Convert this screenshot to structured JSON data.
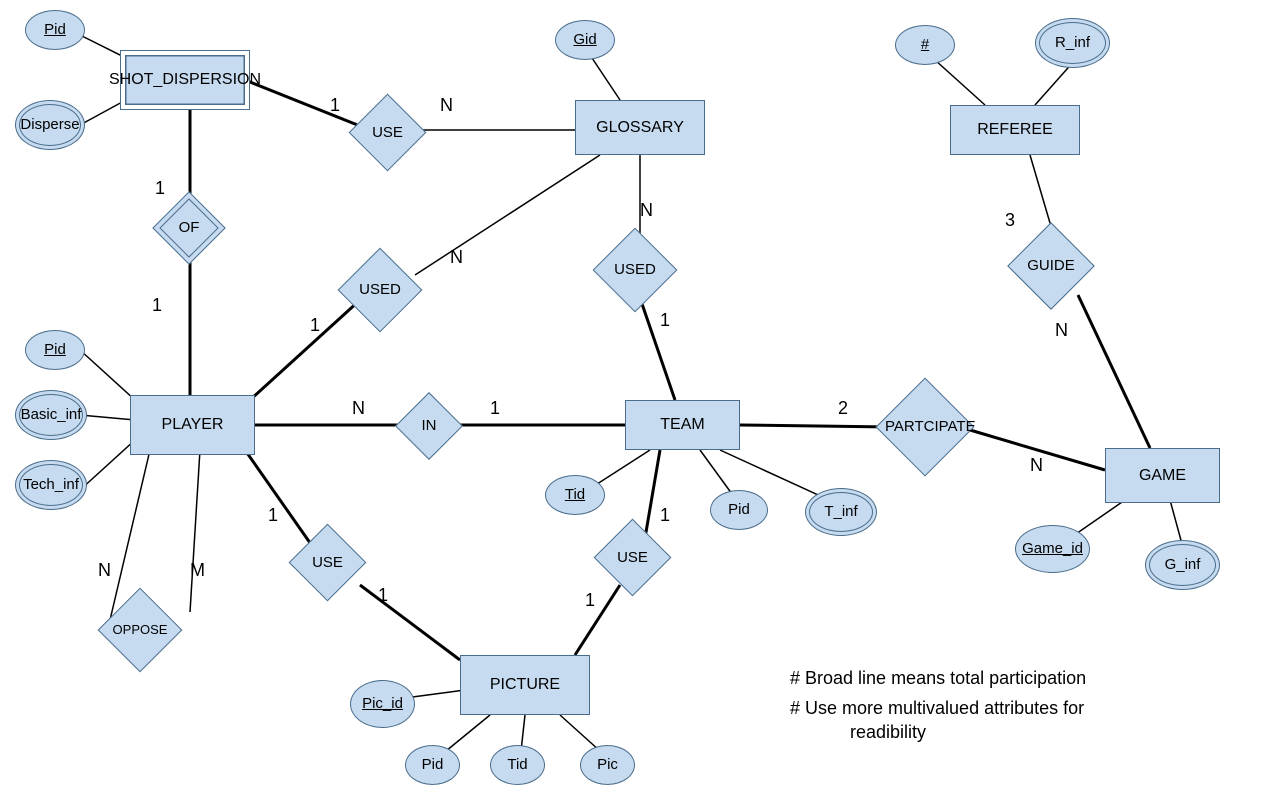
{
  "entities": {
    "shot_dispersion": "SHOT_DISPERSION",
    "glossary": "GLOSSARY",
    "referee": "REFEREE",
    "player": "PLAYER",
    "team": "TEAM",
    "game": "GAME",
    "picture": "PICTURE"
  },
  "attributes": {
    "sd_pid": "Pid",
    "sd_disperse": "Disperse",
    "gl_gid": "Gid",
    "ref_hash": "#",
    "ref_rinf": "R_inf",
    "pl_pid": "Pid",
    "pl_basic": "Basic_inf",
    "pl_tech": "Tech_inf",
    "tm_tid": "Tid",
    "tm_pid": "Pid",
    "tm_tinf": "T_inf",
    "gm_gameid": "Game_id",
    "gm_ginf": "G_inf",
    "pic_picid": "Pic_id",
    "pic_pid": "Pid",
    "pic_tid": "Tid",
    "pic_pic": "Pic"
  },
  "relationships": {
    "use_sd_gl": "USE",
    "of": "OF",
    "used_pl_gl": "USED",
    "used_tm_gl": "USED",
    "in": "IN",
    "participate": "PARTCIPATE",
    "guide": "GUIDE",
    "oppose": "OPPOSE",
    "use_pl_pic": "USE",
    "use_tm_pic": "USE"
  },
  "cardinalities": {
    "use_sd": "1",
    "use_gl": "N",
    "of_sd": "1",
    "of_pl": "1",
    "used_pl_pl": "1",
    "used_pl_gl": "N",
    "used_tm_tm": "1",
    "used_tm_gl": "N",
    "in_pl": "N",
    "in_tm": "1",
    "part_tm": "2",
    "part_gm": "N",
    "guide_ref": "3",
    "guide_gm": "N",
    "oppose_a": "N",
    "oppose_b": "M",
    "use_plpic_pl": "1",
    "use_plpic_pic": "1",
    "use_tmpic_tm": "1",
    "use_tmpic_pic": "1"
  },
  "notes": {
    "n1": "# Broad line means  total participation",
    "n2": "# Use more multivalued attributes for",
    "n3": "readibility"
  }
}
